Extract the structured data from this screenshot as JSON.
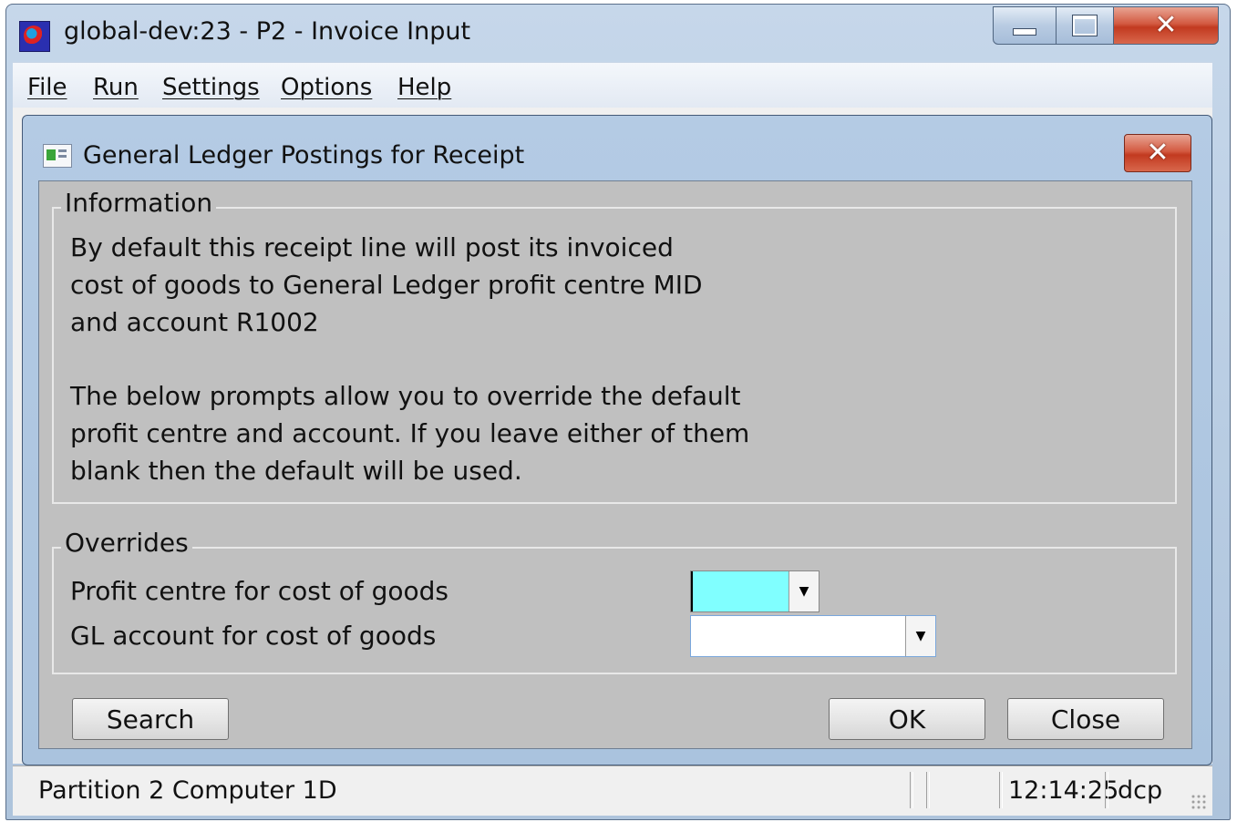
{
  "window": {
    "title": "global-dev:23 - P2 - Invoice Input"
  },
  "menu": {
    "items": [
      {
        "label": "File",
        "underline": "F"
      },
      {
        "label": "Run",
        "underline": "R"
      },
      {
        "label": "Settings",
        "underline": "S"
      },
      {
        "label": "Options",
        "underline": "O"
      },
      {
        "label": "Help",
        "underline": "H"
      }
    ]
  },
  "dialog": {
    "title": "General Ledger Postings for Receipt",
    "information": {
      "legend": "Information",
      "lines": [
        "By default this receipt line will post its invoiced",
        "cost of goods to General Ledger profit centre MID",
        "and account R1002",
        "",
        "The below prompts allow you to override the default",
        "profit centre and account.  If you leave either of them",
        "blank then the default will be used."
      ]
    },
    "overrides": {
      "legend": "Overrides",
      "profit_centre_label": "Profit centre for cost of goods",
      "profit_centre_value": "",
      "gl_account_label": "GL account for cost of goods",
      "gl_account_value": ""
    },
    "buttons": {
      "search": "Search",
      "ok": "OK",
      "close": "Close"
    }
  },
  "status": {
    "partition": "Partition 2 Computer 1D",
    "time": "12:14:25",
    "user": "dcp"
  },
  "colors": {
    "focused_field": "#80ffff",
    "dialog_body": "#c0c0c0",
    "title_close": "#c9452a"
  }
}
